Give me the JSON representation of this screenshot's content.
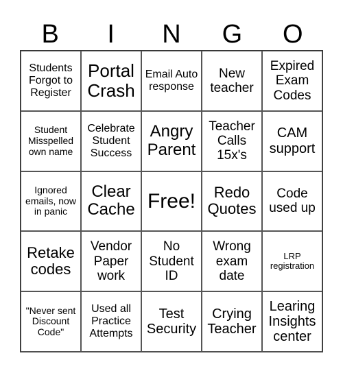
{
  "header": [
    "B",
    "I",
    "N",
    "G",
    "O"
  ],
  "cells": [
    "Students Forgot to Register",
    "Portal Crash",
    "Email Auto response",
    "New teacher",
    "Expired Exam Codes",
    "Student Misspelled own name",
    "Celebrate Student Success",
    "Angry Parent",
    "Teacher Calls 15x's",
    "CAM support",
    "Ignored emails, now in panic",
    "Clear Cache",
    "Free!",
    "Redo Quotes",
    "Code used up",
    "Retake codes",
    "Vendor Paper work",
    "No Student ID",
    "Wrong exam date",
    "LRP registration",
    "\"Never sent Discount Code\"",
    "Used all Practice Attempts",
    "Test Security",
    "Crying Teacher",
    "Learing Insights center"
  ]
}
